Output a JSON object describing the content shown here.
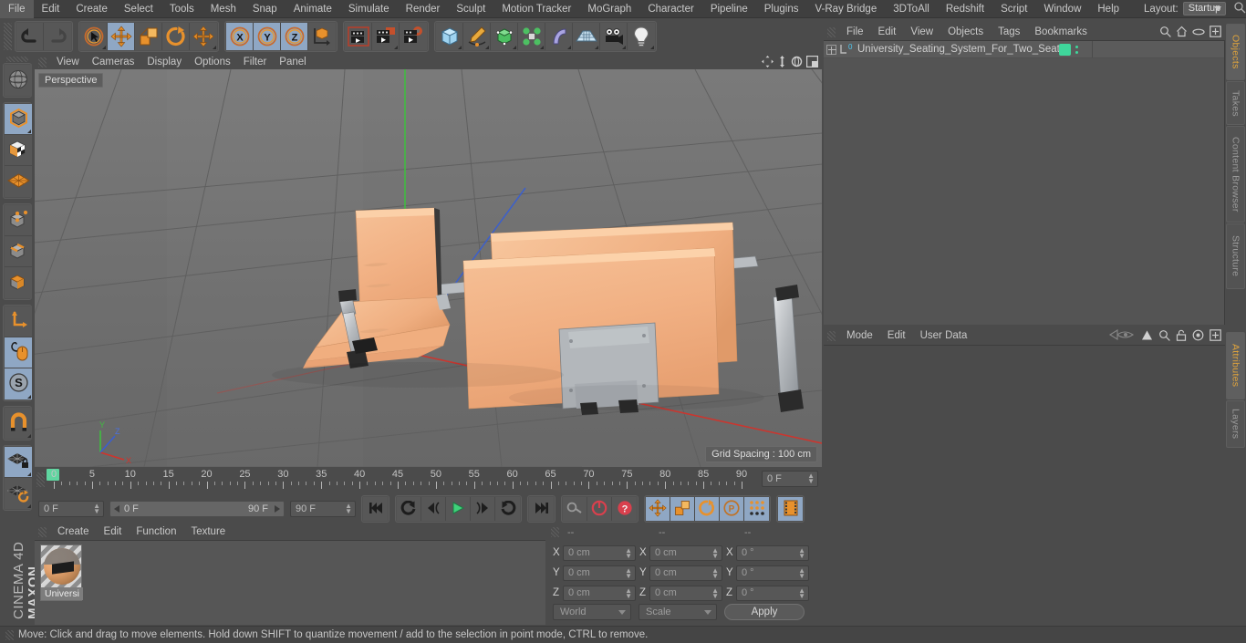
{
  "menubar": {
    "items": [
      "File",
      "Edit",
      "Create",
      "Select",
      "Tools",
      "Mesh",
      "Snap",
      "Animate",
      "Simulate",
      "Render",
      "Sculpt",
      "Motion Tracker",
      "MoGraph",
      "Character",
      "Pipeline",
      "Plugins",
      "V-Ray Bridge",
      "3DToAll",
      "Redshift",
      "Script",
      "Window",
      "Help"
    ],
    "layout_label": "Layout:",
    "layout_value": "Startup",
    "search_icon": "search-icon"
  },
  "toolbar": {
    "groups": [
      {
        "name": "undo-redo",
        "buttons": [
          {
            "name": "undo-button",
            "icon": "undo-arrow-icon",
            "selected": false
          },
          {
            "name": "redo-button",
            "icon": "redo-arrow-icon",
            "selected": false
          }
        ]
      },
      {
        "name": "transform-tools",
        "buttons": [
          {
            "name": "live-selection-tool",
            "icon": "cursor-circle-icon",
            "selected": false
          },
          {
            "name": "move-tool",
            "icon": "move-arrows-icon",
            "selected": true
          },
          {
            "name": "scale-tool",
            "icon": "scale-box-icon",
            "selected": false
          },
          {
            "name": "rotate-tool",
            "icon": "rotate-circle-icon",
            "selected": false
          },
          {
            "name": "dynamic-place-tool",
            "icon": "move-arrows-icon",
            "selected": false
          }
        ]
      },
      {
        "name": "axis-locks",
        "buttons": [
          {
            "name": "x-axis-lock",
            "icon": "x-axis-icon",
            "selected": true
          },
          {
            "name": "y-axis-lock",
            "icon": "y-axis-icon",
            "selected": true
          },
          {
            "name": "z-axis-lock",
            "icon": "z-axis-icon",
            "selected": true
          },
          {
            "name": "world-object-coordinates",
            "icon": "world-axis-cube-icon",
            "selected": false
          }
        ]
      },
      {
        "name": "render-group",
        "buttons": [
          {
            "name": "render-view-button",
            "icon": "render-view-icon",
            "selected": false
          },
          {
            "name": "render-region-button",
            "icon": "render-region-icon",
            "selected": false
          },
          {
            "name": "render-settings-button",
            "icon": "render-settings-icon",
            "selected": false
          }
        ]
      },
      {
        "name": "create-group",
        "buttons": [
          {
            "name": "add-cube-button",
            "icon": "blue-cube-icon",
            "selected": false
          },
          {
            "name": "add-spline-button",
            "icon": "pen-spline-icon",
            "selected": false
          },
          {
            "name": "add-generator-button",
            "icon": "green-cube-icon",
            "selected": false
          },
          {
            "name": "add-mograph-button",
            "icon": "cloner-cubes-icon",
            "selected": false
          },
          {
            "name": "add-deformer-button",
            "icon": "bend-deformer-icon",
            "selected": false
          },
          {
            "name": "add-environment-button",
            "icon": "floor-grid-icon",
            "selected": false
          },
          {
            "name": "add-camera-button",
            "icon": "camera-icon",
            "selected": false
          },
          {
            "name": "add-light-button",
            "icon": "lightbulb-icon",
            "selected": false
          }
        ]
      }
    ]
  },
  "lefttools": {
    "groups": [
      {
        "name": "modelling-mode-group",
        "buttons": [
          {
            "name": "make-editable-button",
            "icon": "globe-wireframe-icon",
            "selected": false
          }
        ]
      },
      {
        "name": "object-mode-group",
        "buttons": [
          {
            "name": "model-mode-button",
            "icon": "model-cube-icon",
            "selected": true
          },
          {
            "name": "texture-mode-button",
            "icon": "texture-checker-cube-icon",
            "selected": false
          },
          {
            "name": "workplane-mode-button",
            "icon": "workplane-grid-icon",
            "selected": false
          }
        ]
      },
      {
        "name": "component-mode-group",
        "buttons": [
          {
            "name": "points-mode-button",
            "icon": "points-cube-icon",
            "selected": false
          },
          {
            "name": "edges-mode-button",
            "icon": "edges-cube-icon",
            "selected": false
          },
          {
            "name": "polygons-mode-button",
            "icon": "polygons-cube-icon",
            "selected": false
          }
        ]
      },
      {
        "name": "axis-group",
        "buttons": [
          {
            "name": "enable-axis-button",
            "icon": "axis-l-icon",
            "selected": false
          },
          {
            "name": "enable-snapping-button",
            "icon": "mouse-snap-icon",
            "selected": true
          },
          {
            "name": "viewport-solo-button",
            "icon": "s-circle-icon",
            "selected": true
          }
        ]
      },
      {
        "name": "magnet-group",
        "buttons": [
          {
            "name": "magnet-tool-button",
            "icon": "magnet-icon",
            "selected": false
          }
        ]
      },
      {
        "name": "workplane-group",
        "buttons": [
          {
            "name": "lock-workplane-button",
            "icon": "workplane-lock-icon",
            "selected": true
          },
          {
            "name": "planar-workplane-button",
            "icon": "workplane-rotate-icon",
            "selected": false
          }
        ]
      }
    ],
    "brand_bold": "MAXON",
    "brand_light": "CINEMA 4D"
  },
  "viewport": {
    "menu": [
      "View",
      "Cameras",
      "Display",
      "Options",
      "Filter",
      "Panel"
    ],
    "label": "Perspective",
    "grid_spacing": "Grid Spacing : 100 cm",
    "axis_labels": {
      "x": "X",
      "y": "Y",
      "z": "Z"
    },
    "nav_icons": [
      "pan-icon",
      "dolly-icon",
      "orbit-icon",
      "maximize-viewport-icon"
    ],
    "colors": {
      "x_axis": "#d0342c",
      "y_axis": "#3fbf3f",
      "z_axis": "#3a5fd0",
      "seat": "#f0b183",
      "frame": "#b9bcc0"
    }
  },
  "timeline": {
    "ticks": [
      "0",
      "5",
      "10",
      "15",
      "20",
      "25",
      "30",
      "35",
      "40",
      "45",
      "50",
      "55",
      "60",
      "65",
      "70",
      "75",
      "80",
      "85",
      "90"
    ],
    "current_frame_field": "0 F"
  },
  "transport": {
    "current_frame": "0 F",
    "range_start": "0 F",
    "range_end": "90 F",
    "end_frame": "90 F",
    "buttons": [
      {
        "name": "go-to-start-button",
        "icon": "skip-start-icon",
        "selected": false
      },
      {
        "name": "play-backwards-loop-button",
        "icon": "loop-back-icon",
        "selected": false
      },
      {
        "name": "previous-frame-button",
        "icon": "step-back-icon",
        "selected": false
      },
      {
        "name": "play-button",
        "icon": "play-icon",
        "selected": false
      },
      {
        "name": "next-frame-button",
        "icon": "step-forward-icon",
        "selected": false
      },
      {
        "name": "play-forwards-loop-button",
        "icon": "loop-forward-icon",
        "selected": false
      },
      {
        "name": "go-to-end-button",
        "icon": "skip-end-icon",
        "selected": false
      },
      {
        "name": "record-active-objects-button",
        "icon": "key-icon",
        "selected": false
      },
      {
        "name": "autokeying-button",
        "icon": "red-circle-icon",
        "selected": false
      },
      {
        "name": "keyframe-selection-button",
        "icon": "red-question-icon",
        "selected": false
      },
      {
        "name": "position-key-button",
        "icon": "move-arrows-icon",
        "selected": true
      },
      {
        "name": "scale-key-button",
        "icon": "scale-box-icon",
        "selected": true
      },
      {
        "name": "rotation-key-button",
        "icon": "rotate-circle-icon",
        "selected": true
      },
      {
        "name": "parameter-key-button",
        "icon": "p-circle-icon",
        "selected": true
      },
      {
        "name": "point-level-animation-button",
        "icon": "pla-dots-icon",
        "selected": true
      },
      {
        "name": "timeline-toggle-button",
        "icon": "film-strip-icon",
        "selected": true
      }
    ]
  },
  "material_manager": {
    "menu": [
      "Create",
      "Edit",
      "Function",
      "Texture"
    ],
    "materials": [
      {
        "name": "Universi"
      }
    ]
  },
  "coordinates": {
    "headers": [
      "--",
      "--",
      "--"
    ],
    "axes": [
      "X",
      "Y",
      "Z"
    ],
    "position": [
      "0 cm",
      "0 cm",
      "0 cm"
    ],
    "size": [
      "0 cm",
      "0 cm",
      "0 cm"
    ],
    "rotation": [
      "0 °",
      "0 °",
      "0 °"
    ],
    "coord_system": "World",
    "size_mode": "Scale",
    "apply_label": "Apply"
  },
  "object_manager": {
    "menu": [
      "File",
      "Edit",
      "View",
      "Objects",
      "Tags",
      "Bookmarks"
    ],
    "icons": [
      "search-icon",
      "home-icon",
      "ellipse-icon",
      "add-layer-icon"
    ],
    "rows": [
      {
        "name": "University_Seating_System_For_Two_Seats",
        "level_badge": "0"
      }
    ]
  },
  "attributes": {
    "menu": [
      "Mode",
      "Edit",
      "User Data"
    ],
    "icons": [
      "history-icon",
      "arrow-up-icon",
      "search-icon",
      "lock-icon",
      "target-icon",
      "add-icon"
    ]
  },
  "vtabs_top": [
    "Objects",
    "Takes",
    "Content Browser",
    "Structure"
  ],
  "vtabs_bottom": [
    "Attributes",
    "Layers"
  ],
  "statusbar": {
    "message": "Move: Click and drag to move elements. Hold down SHIFT to quantize movement / add to the selection in point mode, CTRL to remove."
  }
}
